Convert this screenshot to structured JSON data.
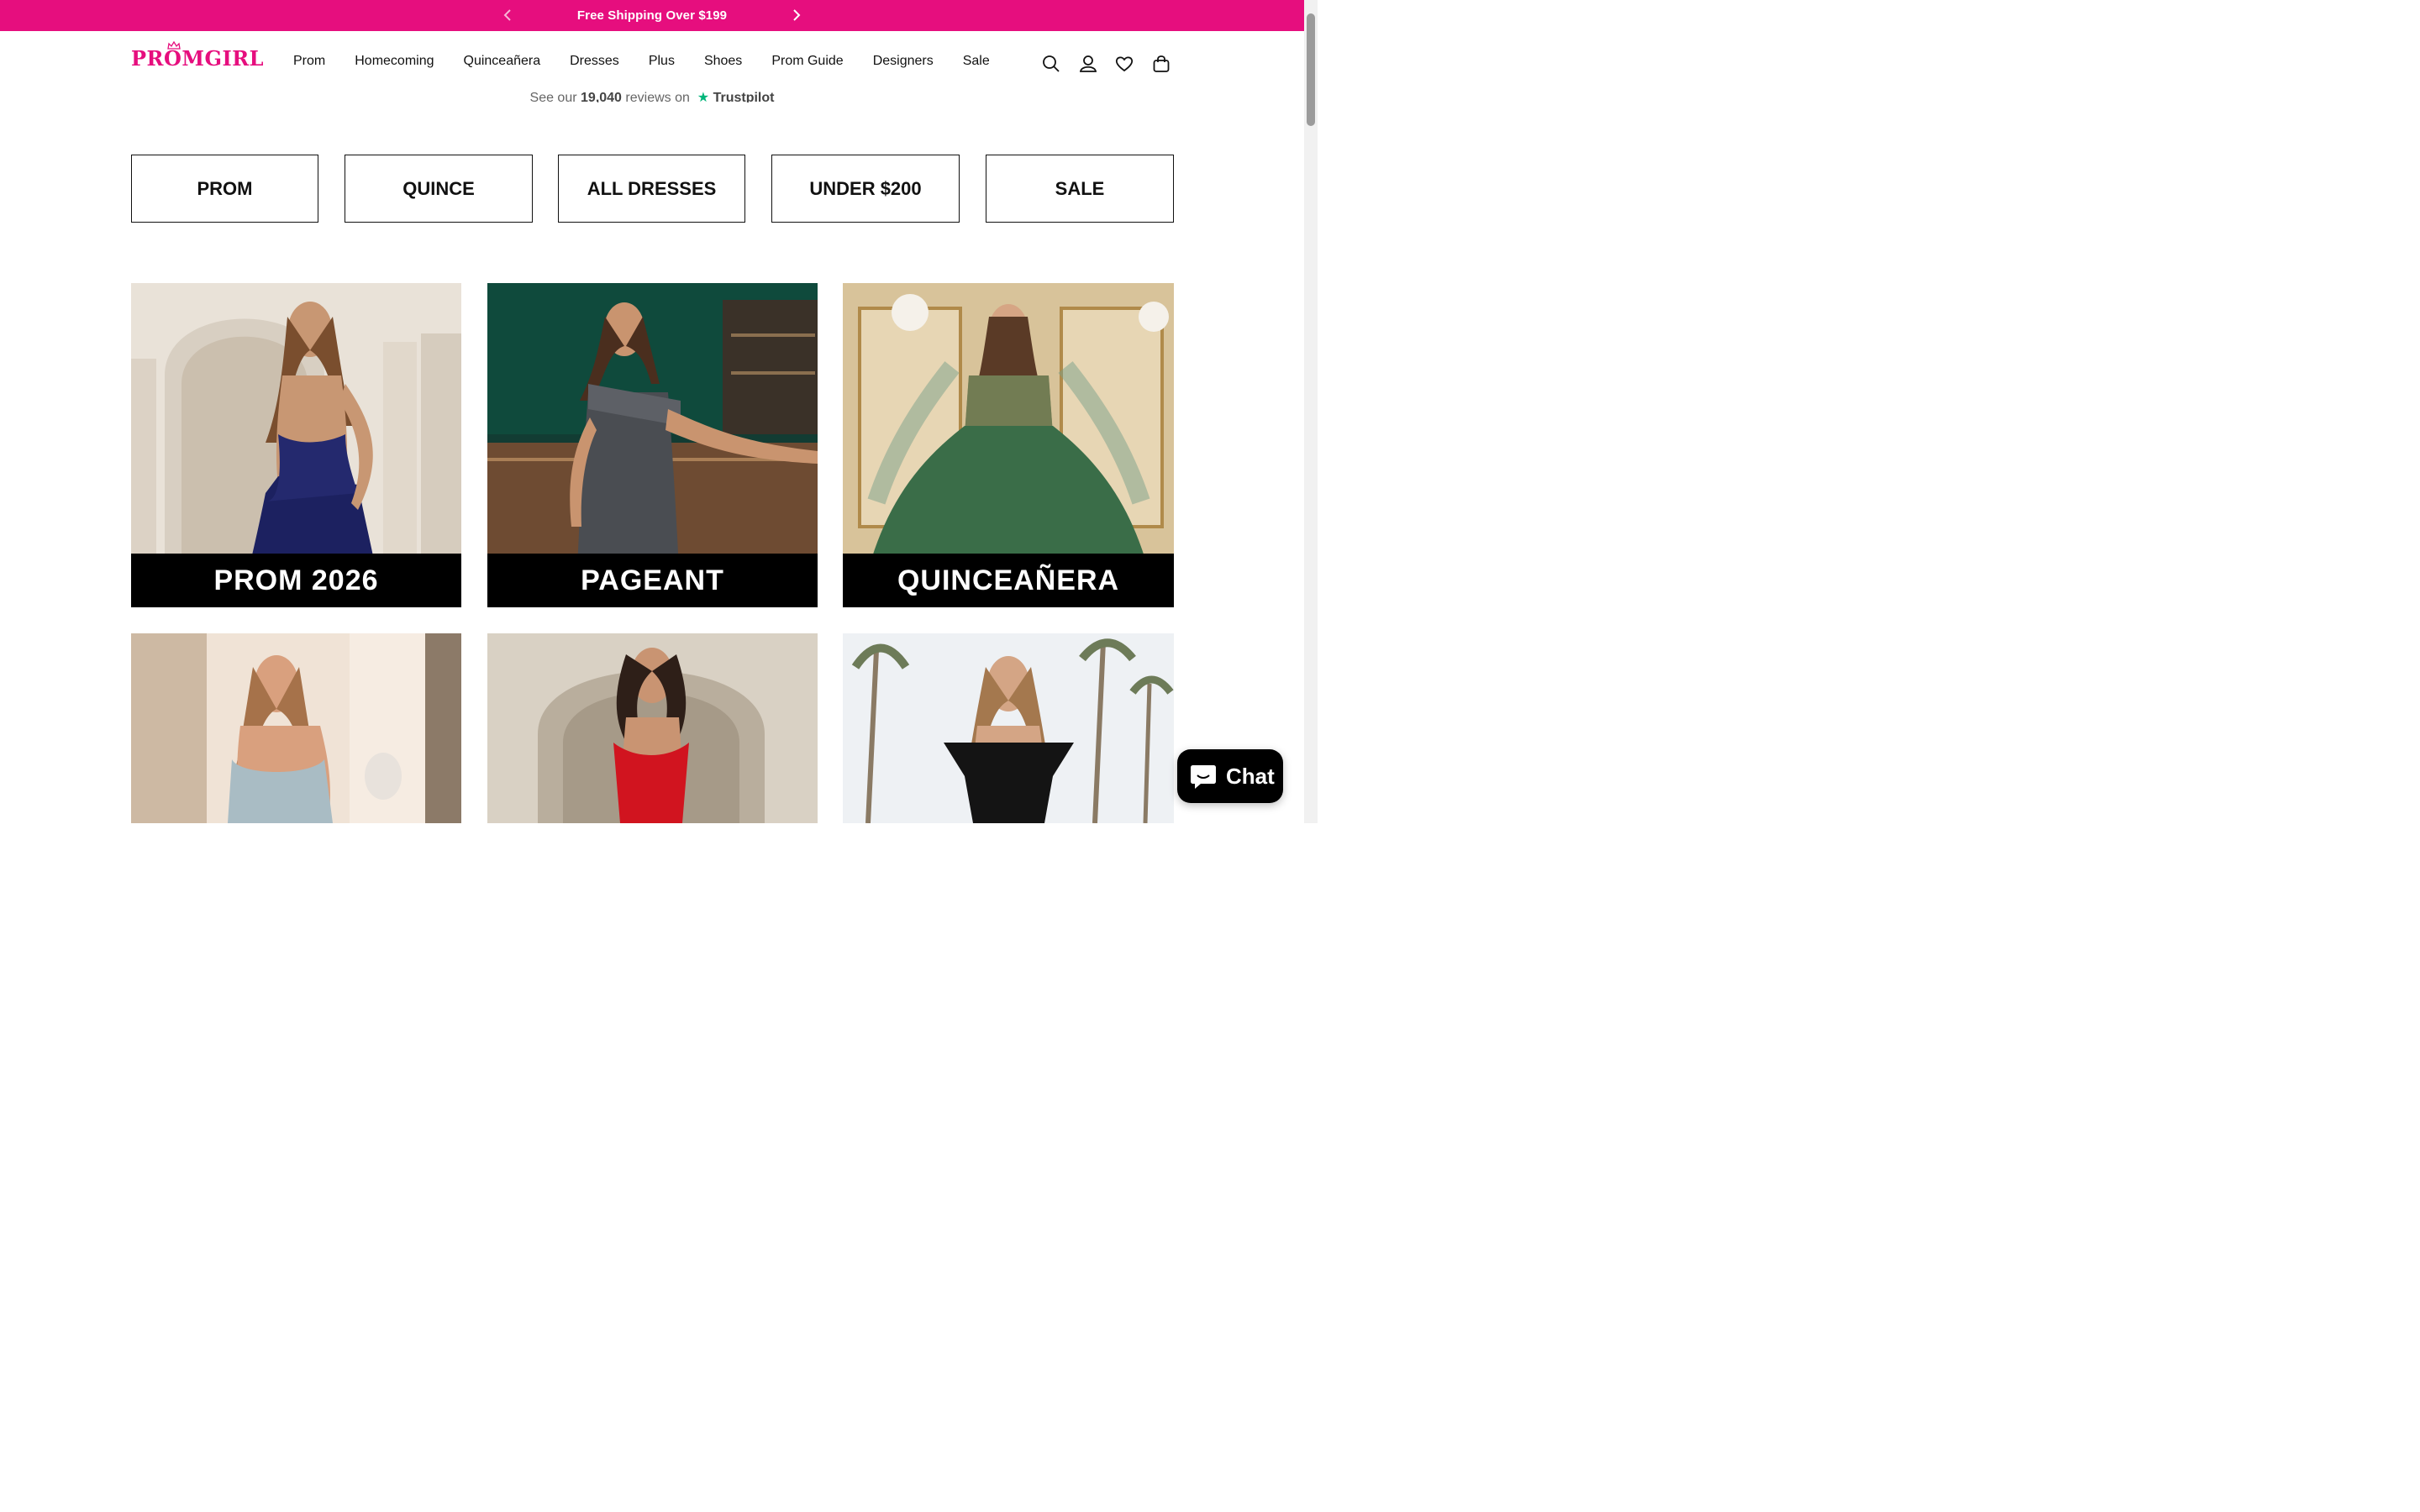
{
  "announcement": {
    "message": "Free Shipping Over $199",
    "prev_icon": "chevron-left-icon",
    "next_icon": "chevron-right-icon",
    "background": "#e60e7e"
  },
  "header": {
    "logo_text": "PROMGIRL",
    "nav": [
      "Prom",
      "Homecoming",
      "Quinceañera",
      "Dresses",
      "Plus",
      "Shoes",
      "Prom Guide",
      "Designers",
      "Sale"
    ],
    "icons": [
      "search-icon",
      "account-icon",
      "wishlist-heart-icon",
      "cart-bag-icon"
    ]
  },
  "trustpilot": {
    "prefix": "See our",
    "count": "19,040",
    "suffix": "reviews on",
    "brand": "Trustpilot"
  },
  "categories": [
    "PROM",
    "QUINCE",
    "ALL DRESSES",
    "UNDER $200",
    "SALE"
  ],
  "tiles": [
    {
      "label": "PROM 2026",
      "dress_color": "#1c2160"
    },
    {
      "label": "PAGEANT",
      "dress_color": "#4a4d52"
    },
    {
      "label": "QUINCEAÑERA",
      "dress_color": "#0f5a3a"
    },
    {
      "label": "",
      "dress_color": "#a9bcc4"
    },
    {
      "label": "",
      "dress_color": "#d1141f"
    },
    {
      "label": "",
      "dress_color": "#141414"
    }
  ],
  "chat": {
    "label": "Chat",
    "icon": "chat-bubble-icon"
  },
  "colors": {
    "brand": "#e60e7e",
    "text": "#111111"
  }
}
